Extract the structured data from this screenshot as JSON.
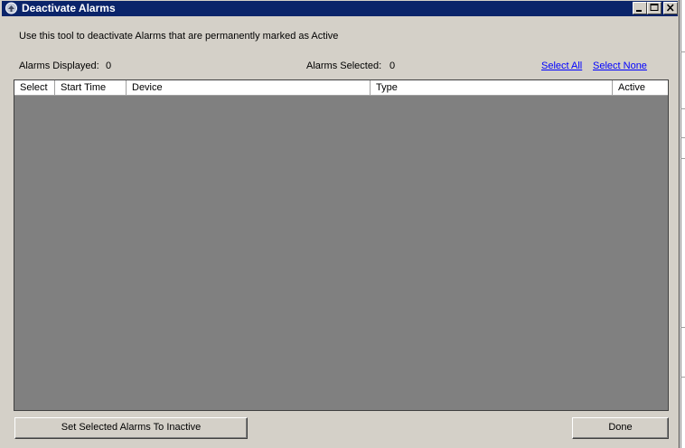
{
  "window": {
    "title": "Deactivate Alarms",
    "icon": "alarm-app-icon",
    "controls": {
      "minimize": "minimize-icon",
      "maximize": "maximize-icon",
      "close": "close-icon"
    }
  },
  "intro_text": "Use this tool to deactivate Alarms that are permanently marked as Active",
  "stats": {
    "displayed_label": "Alarms Displayed:",
    "displayed_value": "0",
    "selected_label": "Alarms Selected:",
    "selected_value": "0"
  },
  "links": {
    "select_all": "Select All",
    "select_none": "Select None"
  },
  "grid": {
    "columns": [
      "Select",
      "Start Time",
      "Device",
      "Type",
      "Active"
    ],
    "rows": []
  },
  "buttons": {
    "set_inactive": "Set Selected Alarms To Inactive",
    "done": "Done"
  },
  "colors": {
    "titlebar": "#0a246a",
    "face": "#d4d0c8",
    "grid_empty": "#808080",
    "link": "#0000ff"
  }
}
